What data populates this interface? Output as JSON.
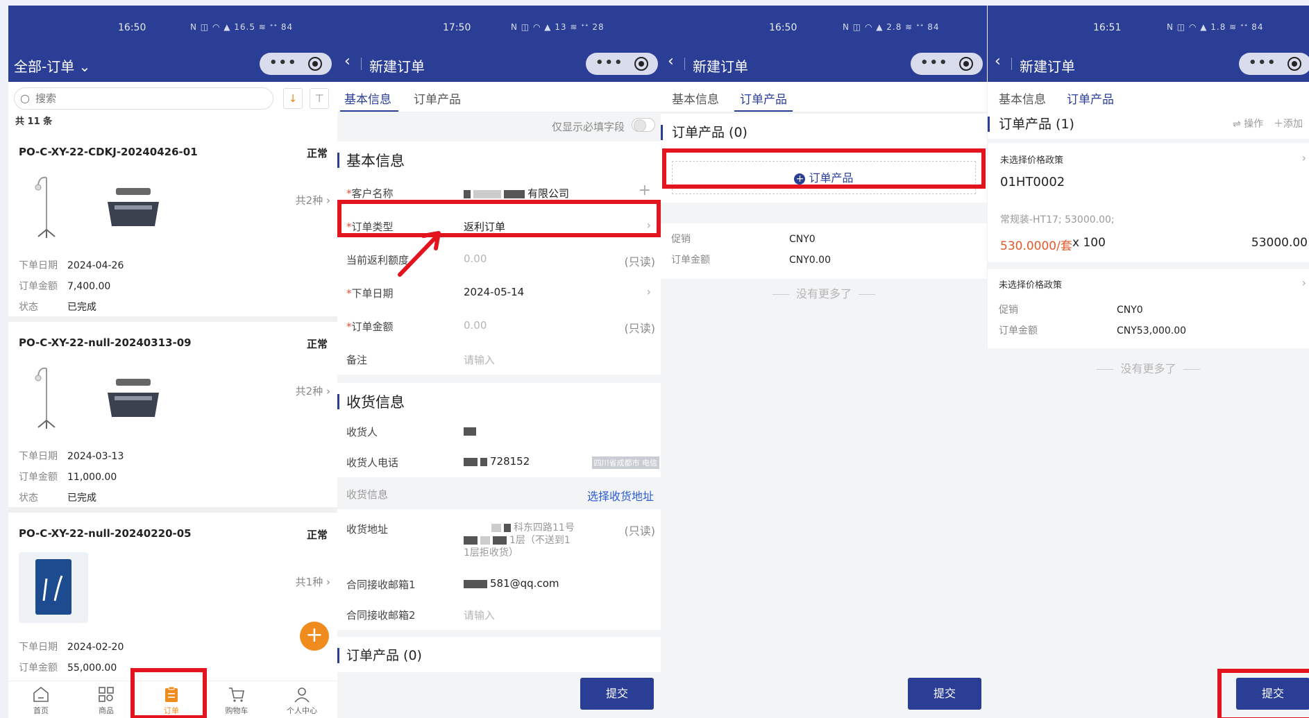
{
  "panel1": {
    "status_time": "16:50",
    "status_icons": "N ◫ ◠ ▲ 16.5 ≋ ᐩᐩ 84",
    "title": "全部-订单",
    "search_placeholder": "搜索",
    "count": "共 11 条",
    "orders": [
      {
        "code": "PO-C-XY-22-CDKJ-20240426-01",
        "state": "正常",
        "kinds": "共2种",
        "date_label": "下单日期",
        "date": "2024-04-26",
        "amount_label": "订单金额",
        "amount": "7,400.00",
        "status_label": "状态",
        "status": "已完成"
      },
      {
        "code": "PO-C-XY-22-null-20240313-09",
        "state": "正常",
        "kinds": "共2种",
        "date_label": "下单日期",
        "date": "2024-03-13",
        "amount_label": "订单金额",
        "amount": "11,000.00",
        "status_label": "状态",
        "status": "已完成"
      },
      {
        "code": "PO-C-XY-22-null-20240220-05",
        "state": "正常",
        "kinds": "共1种",
        "date_label": "下单日期",
        "date": "2024-02-20",
        "amount_label": "订单金额",
        "amount": "55,000.00"
      }
    ],
    "tabs": [
      "首页",
      "商品",
      "订单",
      "购物车",
      "个人中心"
    ],
    "tab_active": 2
  },
  "panel2": {
    "status_time": "17:50",
    "status_icons": "N ◫ ◠ ▲ 13 ≋ ᐩᐩ 28",
    "title": "新建订单",
    "tabs": [
      "基本信息",
      "订单产品"
    ],
    "required_only": "仅显示必填字段",
    "section_basic": "基本信息",
    "customer_label": "客户名称",
    "customer_value": "有限公司",
    "type_label": "订单类型",
    "type_value": "返利订单",
    "rebate_label": "当前返利额度",
    "rebate_value": "0.00",
    "readonly": "(只读)",
    "date_label": "下单日期",
    "date_value": "2024-05-14",
    "amount_label": "订单金额",
    "amount_value": "0.00",
    "remark_label": "备注",
    "remark_ph": "请输入",
    "section_ship": "收货信息",
    "receiver_label": "收货人",
    "phone_label": "收货人电话",
    "phone_value": "728152",
    "phone_tag": "四川省成都市 电信",
    "ship_info_label": "收货信息",
    "choose_address": "选择收货地址",
    "address_label": "收货地址",
    "address_line1": "科东四路11号",
    "address_line2": "1层（不送到1",
    "address_line3": "1层拒收货）",
    "email1_label": "合同接收邮箱1",
    "email1_value": "581@qq.com",
    "email2_label": "合同接收邮箱2",
    "email2_ph": "请输入",
    "section_products": "订单产品 (0)",
    "submit": "提交"
  },
  "panel3": {
    "status_time": "16:50",
    "status_icons": "N ◫ ◠ ▲ 2.8 ≋ ᐩᐩ 84",
    "title": "新建订单",
    "tabs": [
      "基本信息",
      "订单产品"
    ],
    "section": "订单产品 (0)",
    "add_product": "订单产品",
    "promo_label": "促销",
    "promo_value": "CNY0",
    "amount_label": "订单金额",
    "amount_value": "CNY0.00",
    "no_more": "没有更多了",
    "submit": "提交"
  },
  "panel4": {
    "status_time": "16:51",
    "status_icons": "N ◫ ◠ ▲ 1.8 ≋ ᐩᐩ 84",
    "title": "新建订单",
    "tabs": [
      "基本信息",
      "订单产品"
    ],
    "section": "订单产品 (1)",
    "action": "操作",
    "add": "添加",
    "policy1": "未选择价格政策",
    "product_code": "01HT0002",
    "product_spec": "常规装-HT17; 53000.00;",
    "unit_price": "530.0000/套",
    "qty": "x 100",
    "line_total": "53000.00",
    "policy2": "未选择价格政策",
    "promo_label": "促销",
    "promo_value": "CNY0",
    "amount_label": "订单金额",
    "amount_value": "CNY53,000.00",
    "no_more": "没有更多了",
    "submit": "提交"
  },
  "colors": {
    "brand": "#2a3e96",
    "accent": "#f08c1e",
    "highlight": "#e3141d",
    "price": "#e3592a"
  }
}
